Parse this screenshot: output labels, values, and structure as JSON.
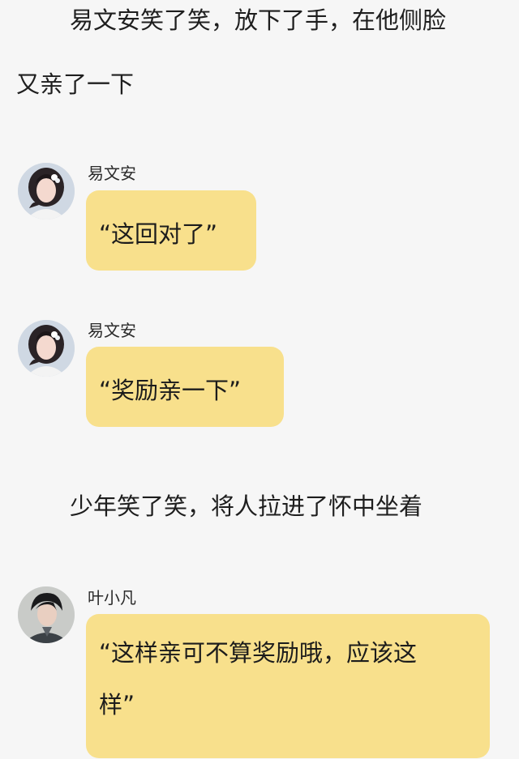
{
  "narration": [
    "易文安笑了笑，放下了手，在他侧脸",
    "又亲了一下",
    "少年笑了笑，将人拉进了怀中坐着"
  ],
  "messages": [
    {
      "sender": "易文安",
      "text": "“这回对了”",
      "avatar": "female-avatar"
    },
    {
      "sender": "易文安",
      "text": "“奖励亲一下”",
      "avatar": "female-avatar"
    },
    {
      "sender": "叶小凡",
      "text_line1": "“这样亲可不算奖励哦，应该这",
      "text_line2": "样”",
      "avatar": "male-avatar"
    }
  ],
  "colors": {
    "background": "#f6f6f6",
    "bubble": "#f8e08c",
    "text": "#1b1b1b"
  }
}
